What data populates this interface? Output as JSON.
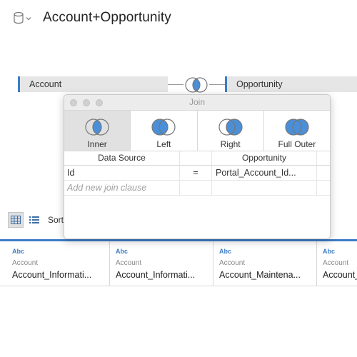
{
  "header": {
    "datasource_title": "Account+Opportunity",
    "icon": "database-icon"
  },
  "canvas": {
    "left_table": "Account",
    "right_table": "Opportunity",
    "join_icon": "inner-join-venn-icon"
  },
  "join_dialog": {
    "title": "Join",
    "join_types": [
      {
        "label": "Inner",
        "icon": "inner-join-icon",
        "selected": true
      },
      {
        "label": "Left",
        "icon": "left-join-icon",
        "selected": false
      },
      {
        "label": "Right",
        "icon": "right-join-icon",
        "selected": false
      },
      {
        "label": "Full Outer",
        "icon": "full-outer-join-icon",
        "selected": false
      }
    ],
    "clause_header": {
      "left": "Data Source",
      "right": "Opportunity"
    },
    "clauses": [
      {
        "left_field": "Id",
        "operator": "=",
        "right_field": "Portal_Account_Id..."
      }
    ],
    "add_clause_placeholder": "Add new join clause"
  },
  "grid_toolbar": {
    "view_grid_icon": "data-grid-icon",
    "view_list_icon": "metadata-list-icon",
    "sort_label": "Sort"
  },
  "fields": [
    {
      "type": "Abc",
      "table": "Account",
      "name": "Account_Informati..."
    },
    {
      "type": "Abc",
      "table": "Account",
      "name": "Account_Informati..."
    },
    {
      "type": "Abc",
      "table": "Account",
      "name": "Account_Maintena..."
    },
    {
      "type": "Abc",
      "table": "Account",
      "name": "Account_"
    }
  ],
  "colors": {
    "accent": "#3d7cc7",
    "venn_fill": "#4a8fd8",
    "pill_bg": "#e6e6e6",
    "selected_join_bg": "#e1e1e1"
  }
}
